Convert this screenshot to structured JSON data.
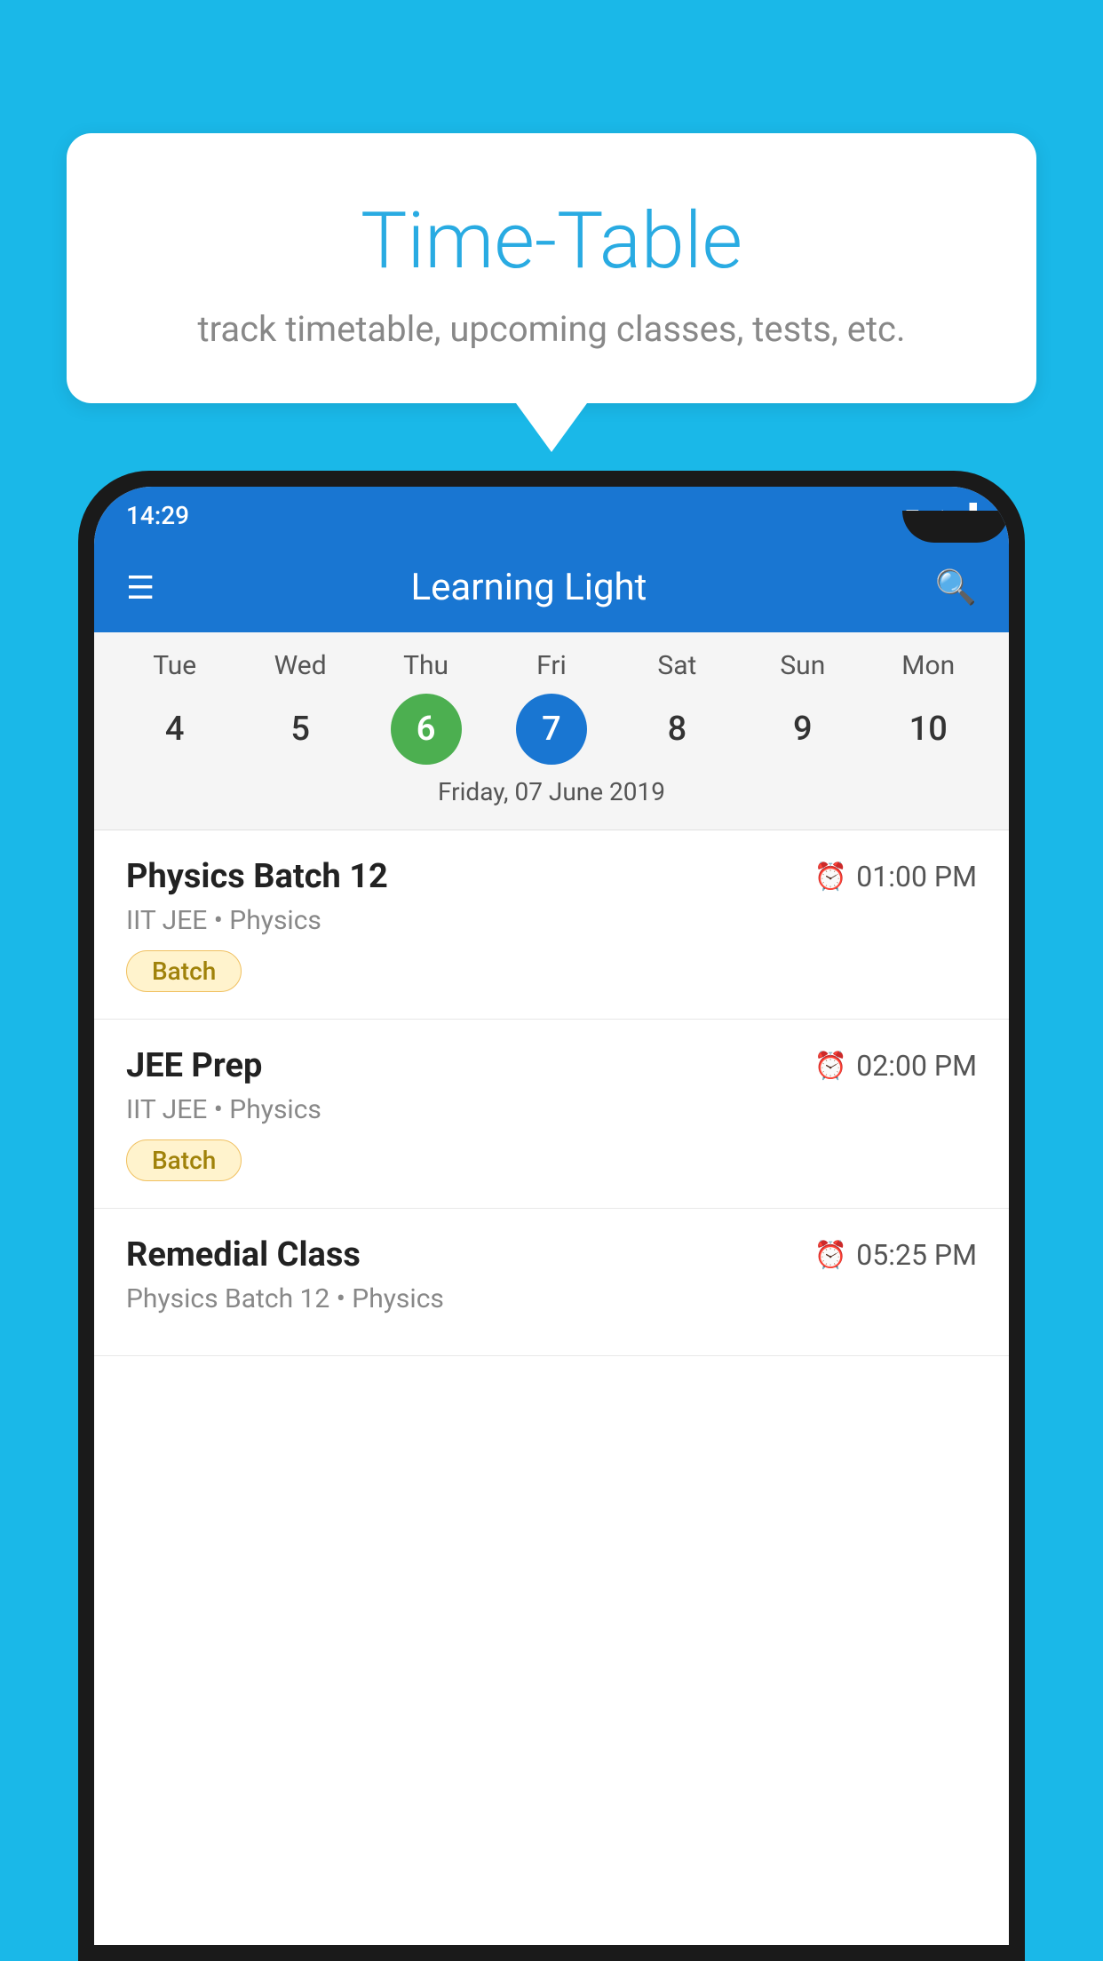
{
  "background_color": "#1AB8E8",
  "speech_bubble": {
    "title": "Time-Table",
    "subtitle": "track timetable, upcoming classes, tests, etc."
  },
  "status_bar": {
    "time": "14:29",
    "wifi_icon": "▼",
    "signal_icon": "▲",
    "battery_icon": "▐"
  },
  "app_bar": {
    "title": "Learning Light",
    "menu_icon": "☰",
    "search_icon": "🔍"
  },
  "calendar": {
    "days": [
      {
        "label": "Tue",
        "number": "4"
      },
      {
        "label": "Wed",
        "number": "5"
      },
      {
        "label": "Thu",
        "number": "6",
        "state": "today"
      },
      {
        "label": "Fri",
        "number": "7",
        "state": "selected"
      },
      {
        "label": "Sat",
        "number": "8"
      },
      {
        "label": "Sun",
        "number": "9"
      },
      {
        "label": "Mon",
        "number": "10"
      }
    ],
    "selected_date_label": "Friday, 07 June 2019"
  },
  "schedule": {
    "items": [
      {
        "id": 1,
        "title": "Physics Batch 12",
        "time": "01:00 PM",
        "subtitle": "IIT JEE • Physics",
        "badge": "Batch"
      },
      {
        "id": 2,
        "title": "JEE Prep",
        "time": "02:00 PM",
        "subtitle": "IIT JEE • Physics",
        "badge": "Batch"
      },
      {
        "id": 3,
        "title": "Remedial Class",
        "time": "05:25 PM",
        "subtitle": "Physics Batch 12 • Physics",
        "badge": null
      }
    ]
  }
}
